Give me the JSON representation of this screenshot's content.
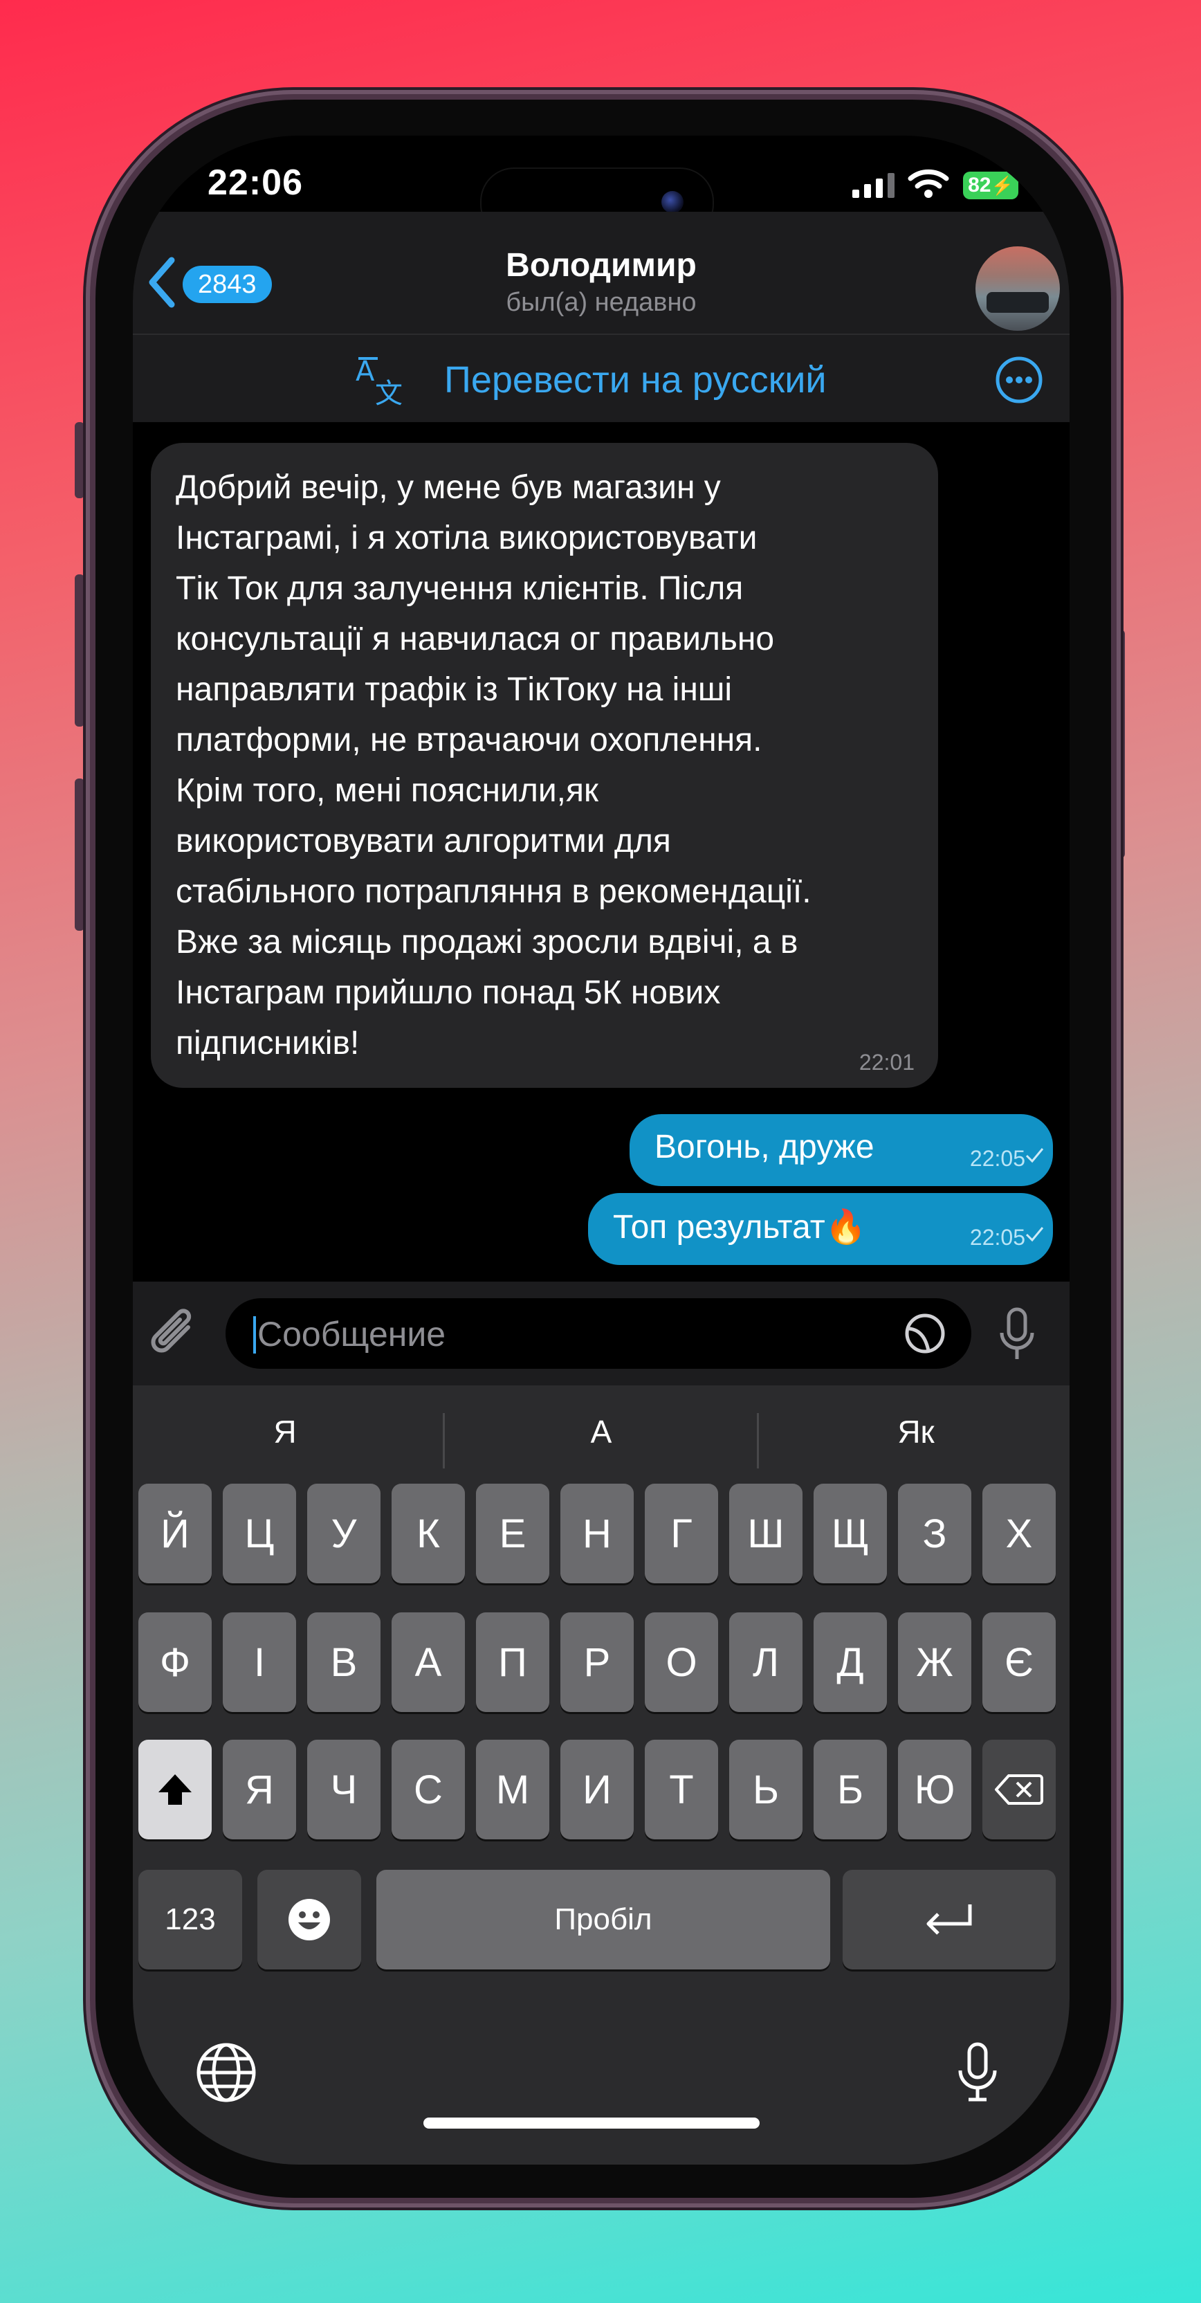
{
  "status_bar": {
    "time": "22:06",
    "battery": "82"
  },
  "header": {
    "back_count": "2843",
    "name": "Володимир",
    "status": "был(а) недавно"
  },
  "translate_bar": {
    "label": "Перевести на русский"
  },
  "messages": {
    "incoming": {
      "text": "Добрий вечір, у мене був магазин у\nІнстаграмі, і я хотіла використовувати\nТік Ток для залучення клієнтів. Після\nконсультації я навчилася ог правильно\nнаправляти трафік із ТікТоку на інші\nплатформи, не втрачаючи охоплення.\nКрім того, мені пояснили,як\nвикористовувати алгоритми для\nстабільного потрапляння в рекомендації.\nВже за місяць продажі зросли вдвічі, а в\nІнстаграм прийшло понад 5К нових\nпідписників!",
      "time": "22:01"
    },
    "outgoing": [
      {
        "text": "Вогонь, друже",
        "time": "22:05"
      },
      {
        "text": "Топ результат🔥",
        "time": "22:05"
      }
    ]
  },
  "input": {
    "placeholder": "Сообщение",
    "value": ""
  },
  "keyboard": {
    "suggestions": [
      "Я",
      "А",
      "Як"
    ],
    "row1": [
      "Й",
      "Ц",
      "У",
      "К",
      "Е",
      "Н",
      "Г",
      "Ш",
      "Щ",
      "З",
      "Х"
    ],
    "row2": [
      "Ф",
      "І",
      "В",
      "А",
      "П",
      "Р",
      "О",
      "Л",
      "Д",
      "Ж",
      "Є"
    ],
    "row3": [
      "Я",
      "Ч",
      "С",
      "М",
      "И",
      "Т",
      "Ь",
      "Б",
      "Ю"
    ],
    "numbers_label": "123",
    "space_label": "Пробіл"
  },
  "colors": {
    "accent": "#3aa8f0",
    "outgoing_bubble": "#1192c6",
    "incoming_bubble": "#262628",
    "battery": "#3ad158"
  },
  "icons": [
    "back-chevron-icon",
    "translate-icon",
    "more-icon",
    "paperclip-icon",
    "sticker-icon",
    "microphone-icon",
    "shift-icon",
    "backspace-icon",
    "emoji-icon",
    "return-icon",
    "globe-icon",
    "dictation-icon"
  ]
}
